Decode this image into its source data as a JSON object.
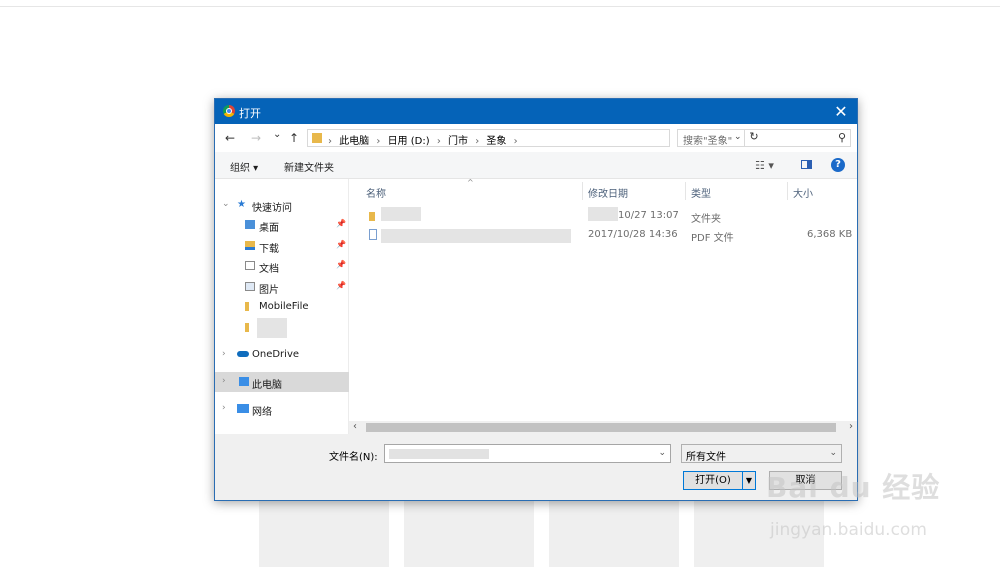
{
  "dialog": {
    "title": "打开",
    "close_glyph": "✕"
  },
  "nav": {
    "back_glyph": "←",
    "forward_glyph": "→",
    "recent_glyph": "⌄",
    "up_glyph": "↑",
    "breadcrumbs": [
      "此电脑",
      "日用 (D:)",
      "门市",
      "圣象"
    ],
    "breadcrumb_sep": "›",
    "refresh_glyph": "↻",
    "search_placeholder": "搜索\"圣象\""
  },
  "toolbar": {
    "organize_label": "组织 ▾",
    "new_folder_label": "新建文件夹",
    "view_glyph": "☷ ▾",
    "help_label": "?"
  },
  "navpane": {
    "quick_access": "快速访问",
    "desktop": "桌面",
    "downloads": "下载",
    "documents": "文档",
    "pictures": "图片",
    "mobilefile": "MobileFile",
    "onedrive": "OneDrive",
    "this_pc": "此电脑",
    "network": "网络"
  },
  "columns": {
    "name": "名称",
    "date": "修改日期",
    "type": "类型",
    "size": "大小"
  },
  "files": [
    {
      "name_visible": "",
      "date": "10/27 13:07",
      "type": "文件夹",
      "size": ""
    },
    {
      "name_visible": "",
      "date": "2017/10/28 14:36",
      "type": "PDF 文件",
      "size": "6,368 KB"
    }
  ],
  "bottom": {
    "filename_label": "文件名(N):",
    "filetype_value": "所有文件",
    "open_label": "打开(O)",
    "cancel_label": "取消"
  },
  "watermark": {
    "top_text": "Bai du 经验",
    "bottom_text": "jingyan.baidu.com"
  },
  "colors": {
    "titlebar": "#0563b8",
    "selection": "#d9d9d9",
    "folder": "#e8b84b"
  }
}
